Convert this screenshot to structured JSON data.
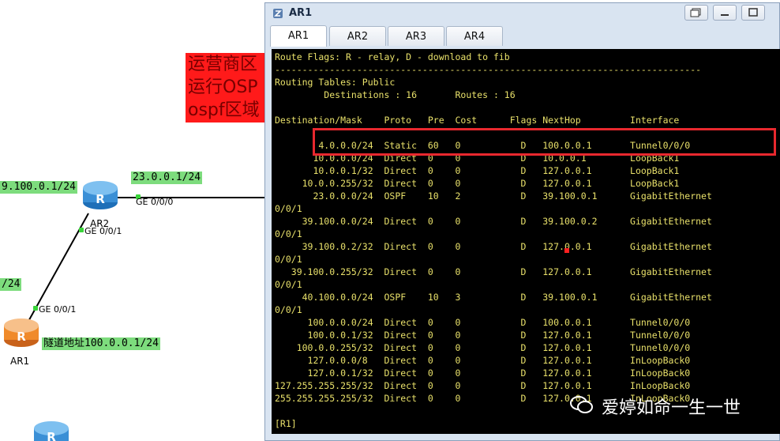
{
  "topology": {
    "note_lines": [
      "运营商区",
      "运行OSP",
      "ospf区域"
    ],
    "labels": {
      "ip_top_left": "9.100.0.1/24",
      "ip_ar2_right": "23.0.0.1/24",
      "ip_left_mid": "/24",
      "tunnel_label": "隧道地址100.0.0.1/24"
    },
    "ports": {
      "ar2_ge000": "GE 0/0/0",
      "ar2_ge001": "GE 0/0/1",
      "ar1_ge001": "GE 0/0/1"
    },
    "devices": {
      "ar2": "AR2",
      "ar1": "AR1"
    },
    "colors": {
      "label_bg": "#7ddc7d",
      "router_blue": "#3a8fd6",
      "router_orange": "#f08a2a",
      "note_bg": "#ff1a1a"
    }
  },
  "window": {
    "title": "AR1",
    "tabs": [
      "AR1",
      "AR2",
      "AR3",
      "AR4"
    ],
    "active_tab": "AR1",
    "terminal_lines": [
      "Route Flags: R - relay, D - download to fib",
      "------------------------------------------------------------------------------",
      "Routing Tables: Public",
      "         Destinations : 16       Routes : 16",
      "",
      "Destination/Mask    Proto   Pre  Cost      Flags NextHop         Interface",
      "",
      "        4.0.0.0/24  Static  60   0           D   100.0.0.1       Tunnel0/0/0",
      "       10.0.0.0/24  Direct  0    0           D   10.0.0.1        LoopBack1",
      "       10.0.0.1/32  Direct  0    0           D   127.0.0.1       LoopBack1",
      "     10.0.0.255/32  Direct  0    0           D   127.0.0.1       LoopBack1",
      "       23.0.0.0/24  OSPF    10   2           D   39.100.0.1      GigabitEthernet",
      "0/0/1",
      "     39.100.0.0/24  Direct  0    0           D   39.100.0.2      GigabitEthernet",
      "0/0/1",
      "     39.100.0.2/32  Direct  0    0           D   127.0.0.1       GigabitEthernet",
      "0/0/1",
      "   39.100.0.255/32  Direct  0    0           D   127.0.0.1       GigabitEthernet",
      "0/0/1",
      "     40.100.0.0/24  OSPF    10   3           D   39.100.0.1      GigabitEthernet",
      "0/0/1",
      "      100.0.0.0/24  Direct  0    0           D   100.0.0.1       Tunnel0/0/0",
      "      100.0.0.1/32  Direct  0    0           D   127.0.0.1       Tunnel0/0/0",
      "    100.0.0.255/32  Direct  0    0           D   127.0.0.1       Tunnel0/0/0",
      "      127.0.0.0/8   Direct  0    0           D   127.0.0.1       InLoopBack0",
      "      127.0.0.1/32  Direct  0    0           D   127.0.0.1       InLoopBack0",
      "127.255.255.255/32  Direct  0    0           D   127.0.0.1       InLoopBack0",
      "255.255.255.255/32  Direct  0    0           D   127.0.0.1       InLoopBack0",
      "",
      "[R1]"
    ],
    "watermark": "爱婷如命一生一世",
    "colors": {
      "terminal_bg": "#000000",
      "terminal_text": "#e8e06a",
      "highlight": "#e8282e"
    }
  }
}
